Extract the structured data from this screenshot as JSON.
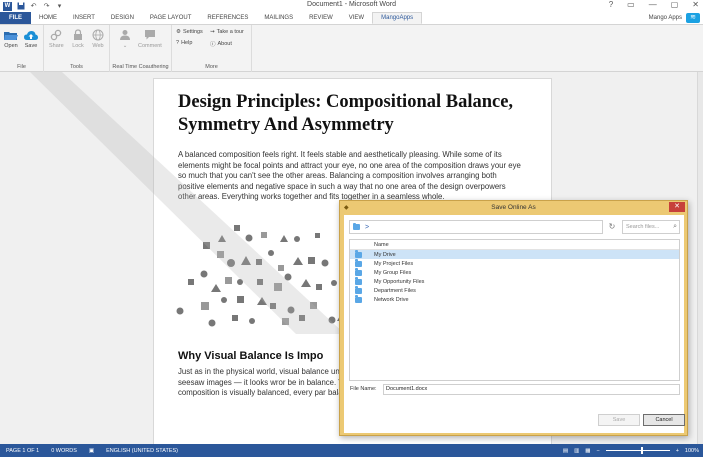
{
  "app": {
    "window_title": "Document1 - Microsoft Word",
    "win_controls": [
      "?",
      "▭",
      "—",
      "▢",
      "✕"
    ]
  },
  "tabs": [
    {
      "label": "FILE"
    },
    {
      "label": "HOME"
    },
    {
      "label": "INSERT"
    },
    {
      "label": "DESIGN"
    },
    {
      "label": "PAGE LAYOUT"
    },
    {
      "label": "REFERENCES"
    },
    {
      "label": "MAILINGS"
    },
    {
      "label": "REVIEW"
    },
    {
      "label": "VIEW"
    },
    {
      "label": "MangoApps"
    }
  ],
  "user": "Mango Apps",
  "ribbon": {
    "groups": {
      "file": "File",
      "tools": "Tools",
      "realtime": "Real Time Coauthering",
      "more": "More"
    },
    "buttons": {
      "open": "Open",
      "save": "Save",
      "share": "Share",
      "lock": "Lock",
      "web": "Web",
      "comment": "Comment",
      "settings": "Settings",
      "help": "Help",
      "tour": "Take a tour",
      "about": "About"
    }
  },
  "document": {
    "title": "Design Principles: Compositional Balance, Symmetry And Asymmetry",
    "paragraph1": "A balanced composition feels right. It feels stable and aesthetically pleasing. While some of its elements might be focal points and attract your eye, no one area of the composition draws your eye so much that you can't see the other areas. Balancing a composition involves arranging both positive elements and negative space in such a way that no one area of the design overpowers other areas. Everything works together and fits together in a seamless whole.",
    "heading2": "Why Visual Balance Is Impo",
    "paragraph2": "Just as in the physical world, visual balance unbalanced composition can feel uncomf of the three seesaw images — it looks wror be in balance. Visual weight is a measure of the visual int composition is visually balanced, every par balanced, which keeps viewers engaged w"
  },
  "statusbar": {
    "page": "PAGE 1 OF 1",
    "words": "0 WORDS",
    "language": "ENGLISH (UNITED STATES)",
    "zoom": "100%",
    "zoom_level": 0.55
  },
  "dialog": {
    "title": "Save Online As",
    "path": ">",
    "search_placeholder": "Search files...",
    "column_name": "Name",
    "items": [
      {
        "name": "My Drive",
        "selected": true
      },
      {
        "name": "My Project Files",
        "selected": false
      },
      {
        "name": "My Group Files",
        "selected": false
      },
      {
        "name": "My Opportunity Files",
        "selected": false
      },
      {
        "name": "Department Files",
        "selected": false
      },
      {
        "name": "Network Drive",
        "selected": false
      }
    ],
    "file_name_label": "File Name:",
    "file_name_value": "Document1.docx",
    "save_label": "Save",
    "cancel_label": "Cancel"
  }
}
